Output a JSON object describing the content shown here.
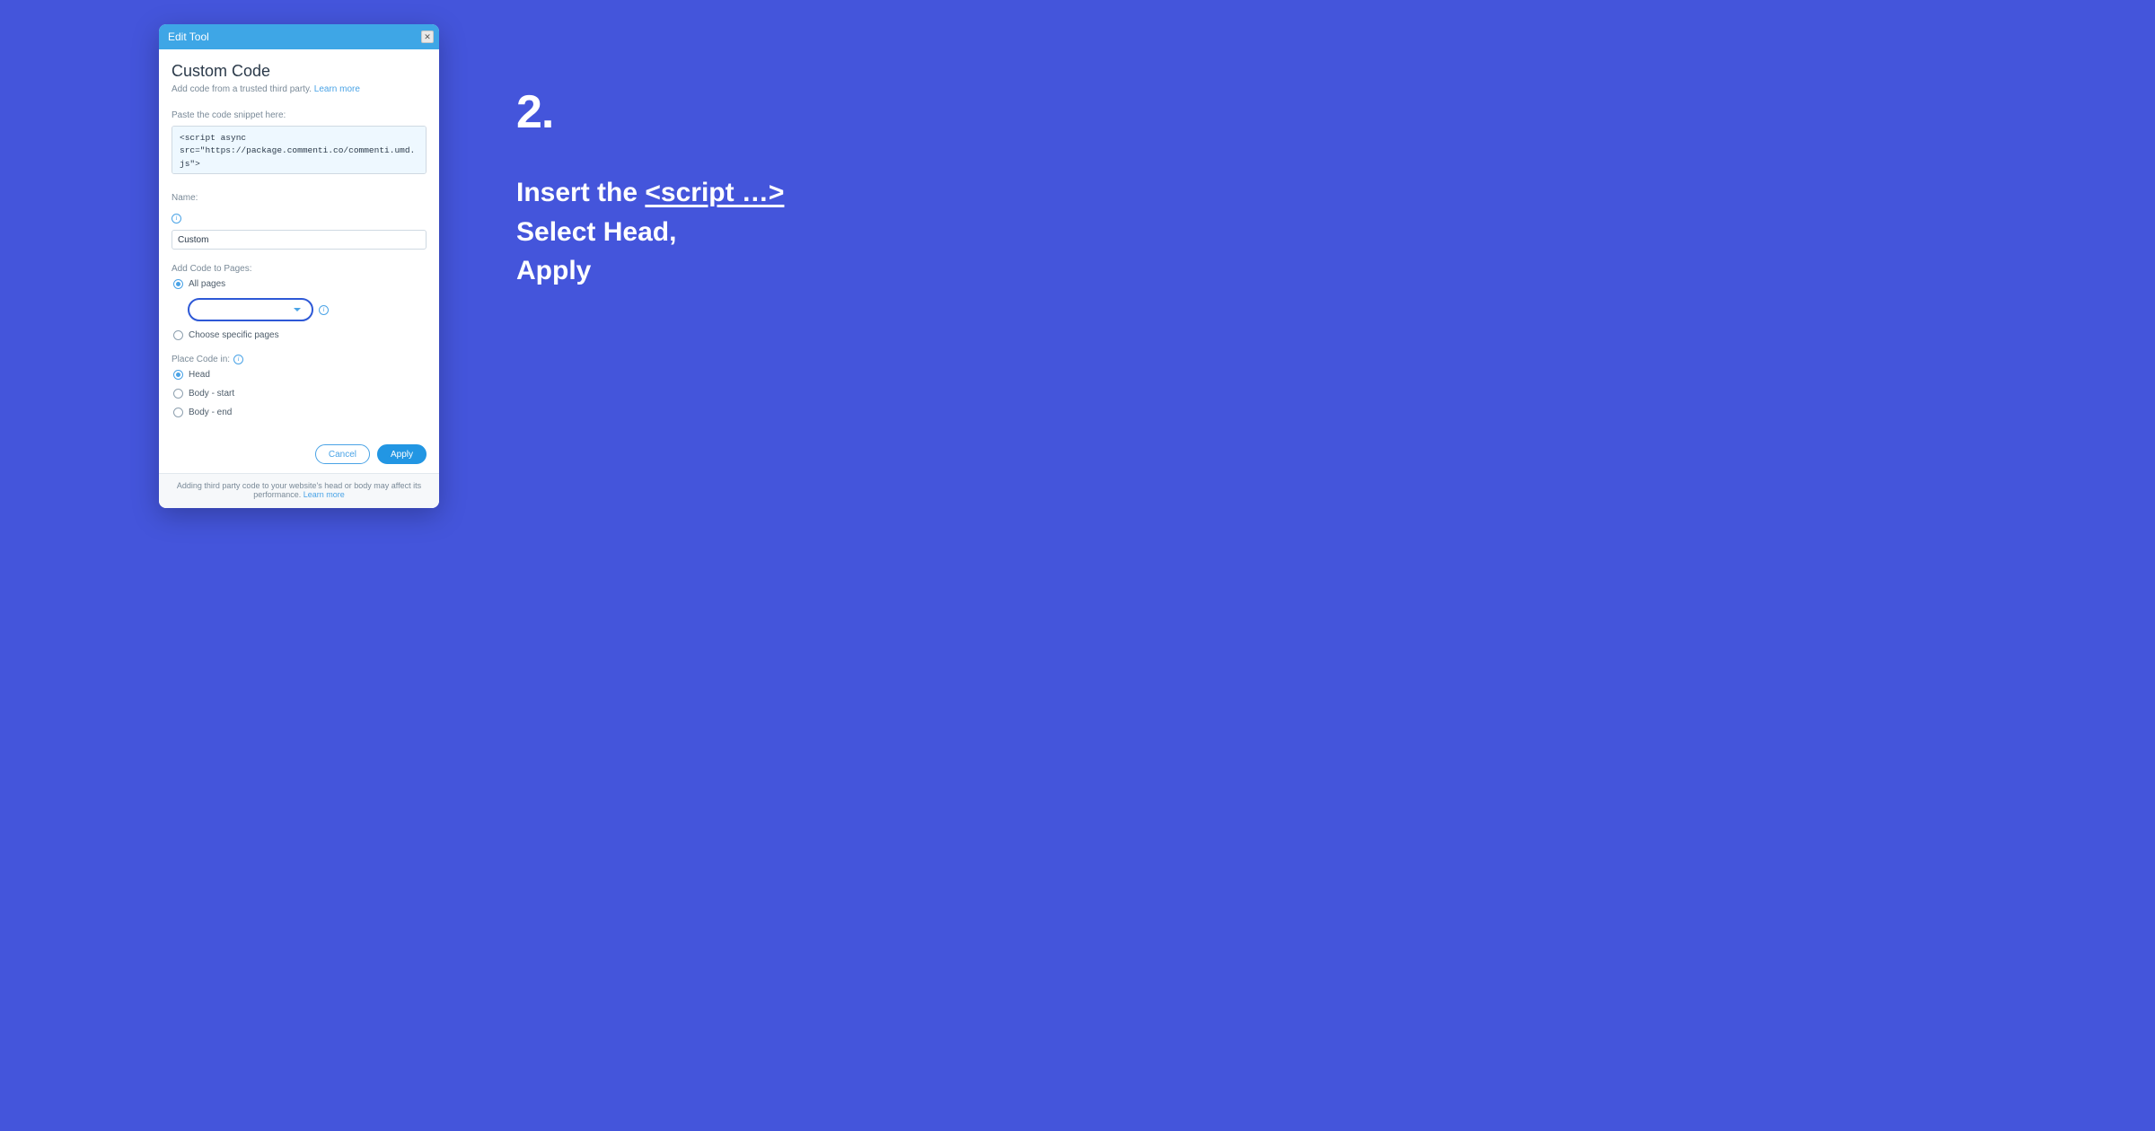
{
  "dialog": {
    "title": "Edit Tool",
    "heading": "Custom Code",
    "subtitle_text": "Add code from a trusted third party. ",
    "subtitle_link": "Learn more",
    "code": {
      "label": "Paste the code snippet here:",
      "value": "<script async\nsrc=\"https://package.commenti.co/commenti.umd.js\">"
    },
    "name": {
      "label": "Name:",
      "value": "Custom"
    },
    "pages": {
      "label": "Add Code to Pages:",
      "options": {
        "all": "All pages",
        "specific": "Choose specific pages"
      },
      "selected": "all"
    },
    "place": {
      "label": "Place Code in:",
      "options": {
        "head": "Head",
        "body_start": "Body - start",
        "body_end": "Body - end"
      },
      "selected": "head"
    },
    "buttons": {
      "cancel": "Cancel",
      "apply": "Apply"
    },
    "footer_text": "Adding third party code to your website's head or body may affect its performance. ",
    "footer_link": "Learn more"
  },
  "instructions": {
    "step": "2.",
    "line1_prefix": "Insert the ",
    "line1_underline": "<script …>",
    "line2": "Select Head,",
    "line3": "Apply"
  }
}
